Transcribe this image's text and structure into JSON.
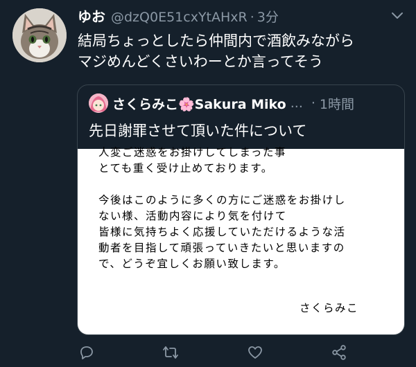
{
  "author": {
    "display_name": "ゆお",
    "handle": "@dzQ0E51cxYtAHxR",
    "separator": "·",
    "time": "3分"
  },
  "tweet": {
    "text": "結局ちょっとしたら仲間内で酒飲みながら\nマジめんどくさいわーとか言ってそう"
  },
  "quoted": {
    "name": "さくらみこ🌸Sakura Miko",
    "ellipsis": "...",
    "separator": "·",
    "time": "1時間",
    "text": "先日謝罪させて頂いた件について",
    "image": {
      "body_lines": "人変ご迷惑をお掛けしてしまった事\nとても重く受け止めております。\n\n今後はこのように多くの方にご迷惑をお掛けし\nない様、活動内容により気を付けて\n皆様に気持ちよく応援していただけるような活\n動者を目指して頑張っていきたいと思いますの\nで、どうぞ宜しくお願い致します。",
      "signature": "さくらみこ"
    }
  },
  "actions": {
    "icons": [
      "reply-icon",
      "retweet-icon",
      "like-icon",
      "share-icon"
    ]
  },
  "colors": {
    "background": "#15202b",
    "secondary_text": "#8b98a5",
    "border": "#38444d",
    "icon": "#8b98a5"
  }
}
